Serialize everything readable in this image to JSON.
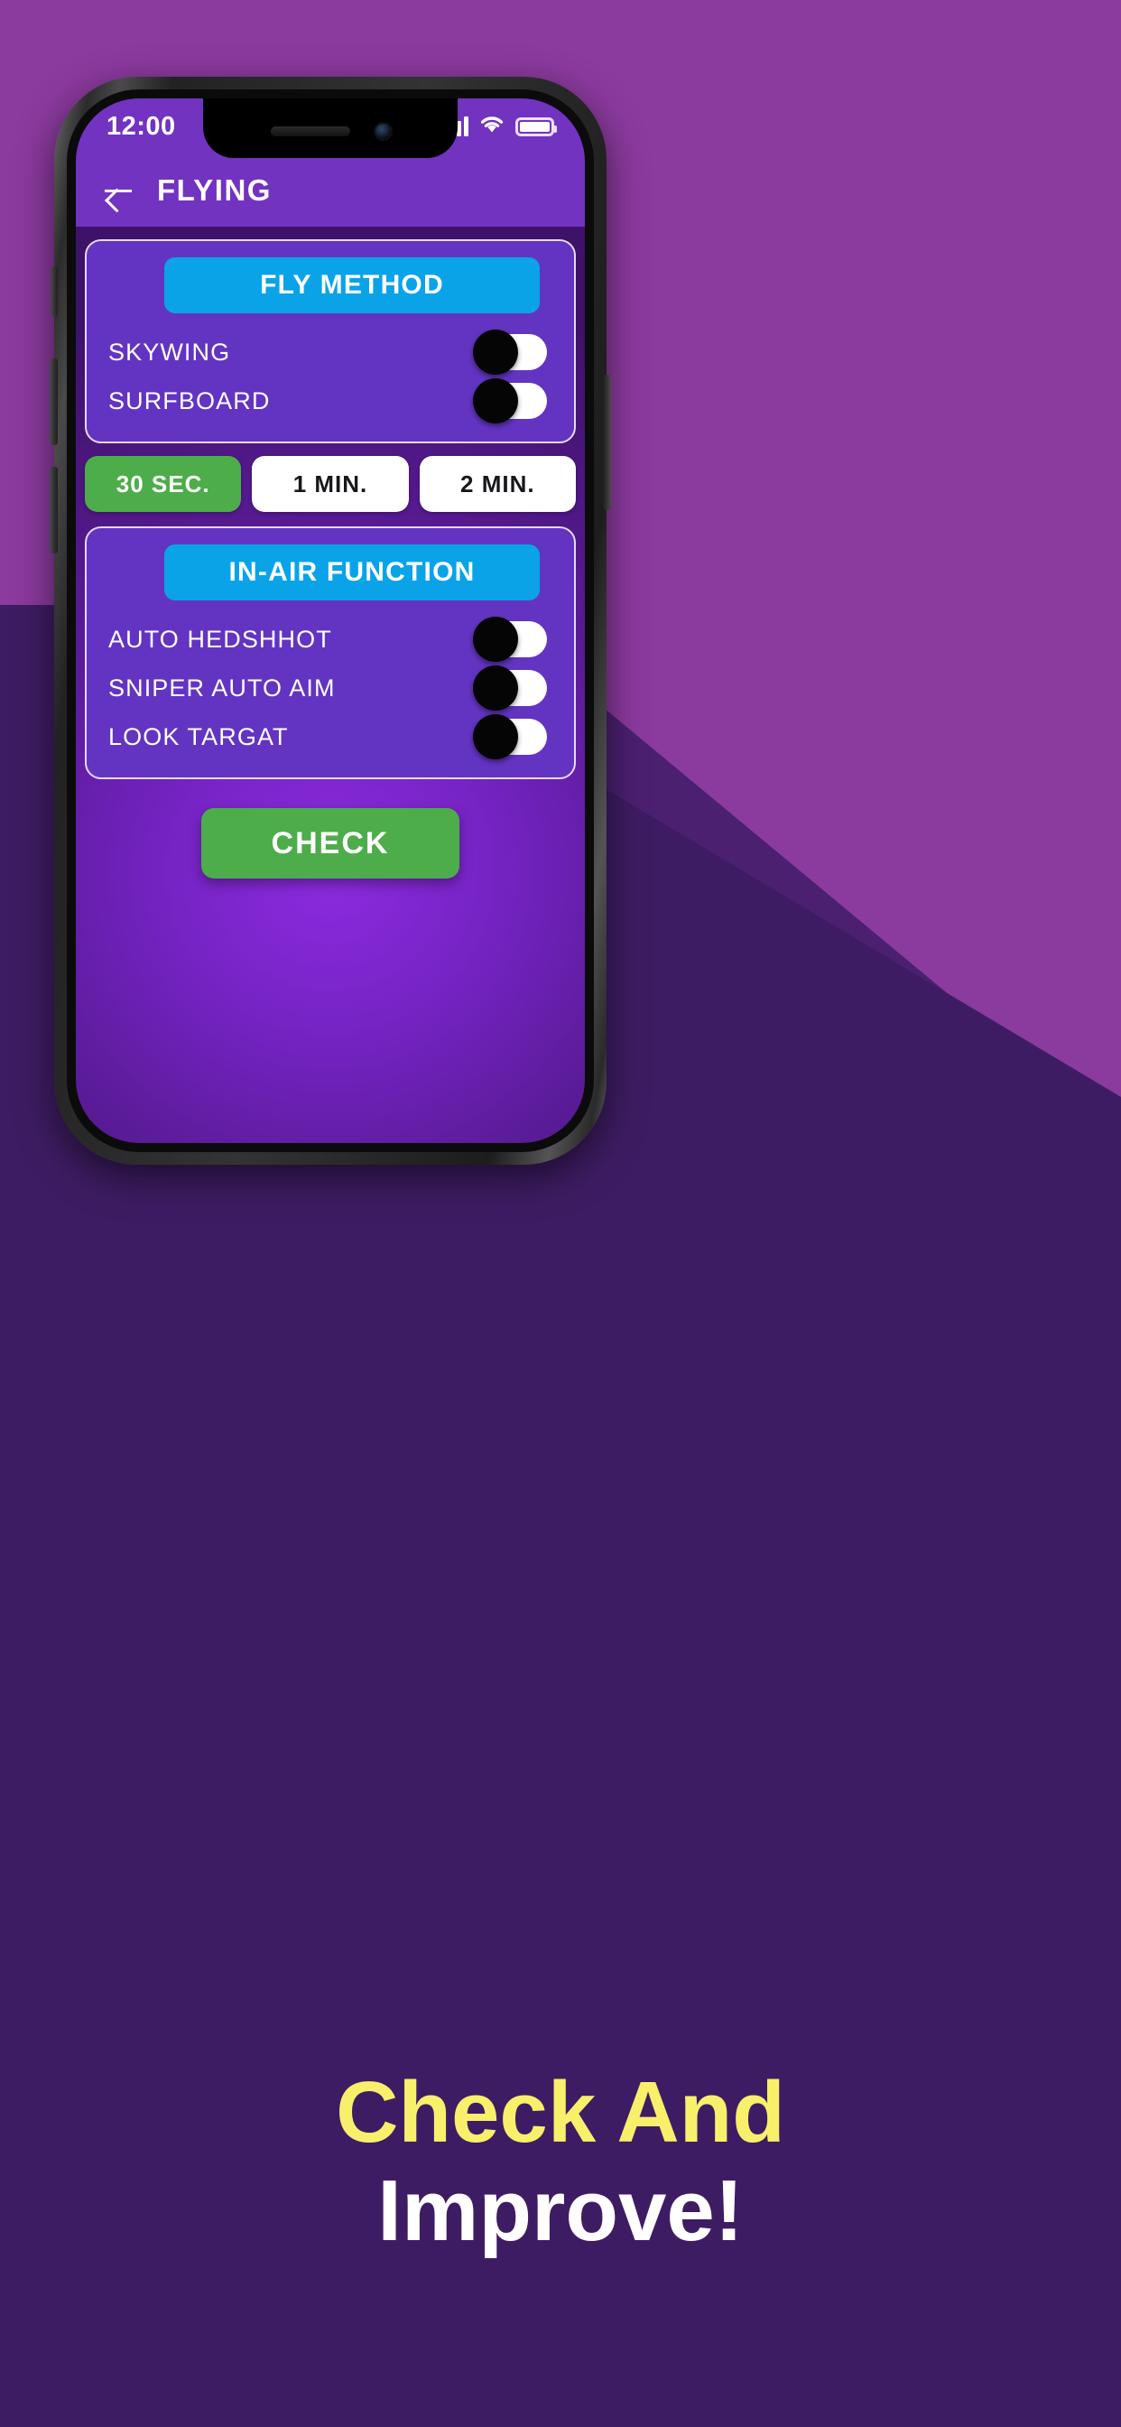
{
  "background": {
    "light_purple": "#8B3A9E",
    "dark_purple": "#3E1C63"
  },
  "phone": {
    "statusbar": {
      "time": "12:00",
      "signal_icon": "signal-bars-icon",
      "wifi_icon": "wifi-icon",
      "battery_icon": "battery-full-icon"
    },
    "appbar": {
      "back_icon": "back-arrow-icon",
      "title": "FLYING"
    },
    "cards": [
      {
        "header": "FLY METHOD",
        "rows": [
          {
            "label": "SKYWING",
            "toggle": "off"
          },
          {
            "label": "SURFBOARD",
            "toggle": "off"
          }
        ]
      },
      {
        "header": "IN-AIR FUNCTION",
        "rows": [
          {
            "label": "AUTO HEDSHHOT",
            "toggle": "off"
          },
          {
            "label": "SNIPER AUTO AIM",
            "toggle": "off"
          },
          {
            "label": "LOOK TARGAT",
            "toggle": "off"
          }
        ]
      }
    ],
    "duration_segments": [
      {
        "label": "30 SEC.",
        "selected": true
      },
      {
        "label": "1 MIN.",
        "selected": false
      },
      {
        "label": "2 MIN.",
        "selected": false
      }
    ],
    "check_button": "CHECK",
    "accent_blue": "#0BA3E8",
    "accent_green": "#4DAD4A",
    "card_purple": "#6334C2",
    "bar_purple": "#7233C0"
  },
  "headline": {
    "line1": "Check And",
    "line2": "Improve!",
    "line1_color": "#F8F06B",
    "line2_color": "#FFFFFF"
  }
}
